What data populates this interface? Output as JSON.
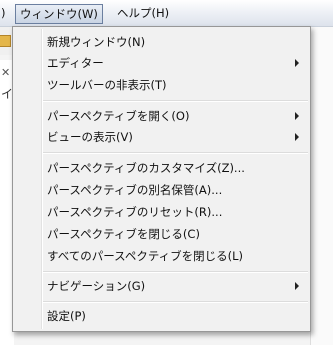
{
  "menubar": {
    "partial_label": ")",
    "window_label": "ウィンドウ(W)",
    "help_label": "ヘルプ(H)"
  },
  "background": {
    "side_char": "イ"
  },
  "menu": {
    "new_window": "新規ウィンドウ(N)",
    "editor": "エディター",
    "hide_toolbar": "ツールバーの非表示(T)",
    "open_perspective": "パースペクティブを開く(O)",
    "show_view": "ビューの表示(V)",
    "customize_perspective": "パースペクティブのカスタマイズ(Z)...",
    "save_perspective_as": "パースペクティブの別名保管(A)...",
    "reset_perspective": "パースペクティブのリセット(R)...",
    "close_perspective": "パースペクティブを閉じる(C)",
    "close_all_perspectives": "すべてのパースペクティブを閉じる(L)",
    "navigation": "ナビゲーション(G)",
    "preferences": "設定(P)"
  },
  "icons": {
    "submenu_arrow": "chevron-right-icon",
    "close": "close-icon"
  }
}
